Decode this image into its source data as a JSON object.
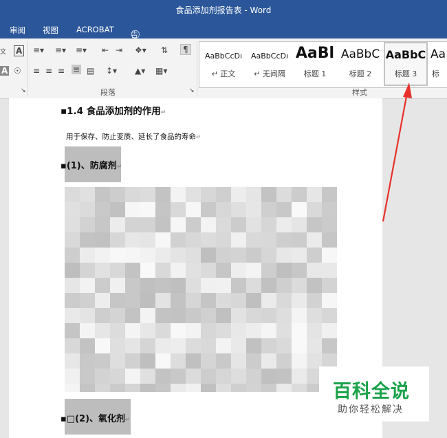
{
  "window": {
    "title": "食品添加剂报告表 - Word"
  },
  "tabs": [
    "审阅",
    "视图",
    "ACROBAT"
  ],
  "tell_me": "告诉我您想要做什么...",
  "ribbon": {
    "groups": {
      "paragraph": "段落",
      "styles": "样式"
    },
    "styles": [
      {
        "sample": "AaBbCcDı",
        "name": "↵ 正文"
      },
      {
        "sample": "AaBbCcDı",
        "name": "↵ 无间隔"
      },
      {
        "sample": "AaBl",
        "name": "标题 1"
      },
      {
        "sample": "AaBbC",
        "name": "标题 2"
      },
      {
        "sample": "AaBbC",
        "name": "标题 3",
        "selected": true
      },
      {
        "sample": "Aa",
        "name": "标"
      }
    ]
  },
  "document": {
    "heading_14": "1.4 食品添加剂的作用",
    "para1": "用于保存、防止变质、延长了食品的寿命",
    "h3_1": "(1)、防腐剂",
    "h3_2": "(2)、氧化剂"
  },
  "watermark": {
    "line1": "百科全说",
    "line2": "助你轻松解决"
  },
  "colors": {
    "title_bar": "#2b579a",
    "arrow": "#e8302b",
    "watermark_green": "#1aa24a"
  }
}
